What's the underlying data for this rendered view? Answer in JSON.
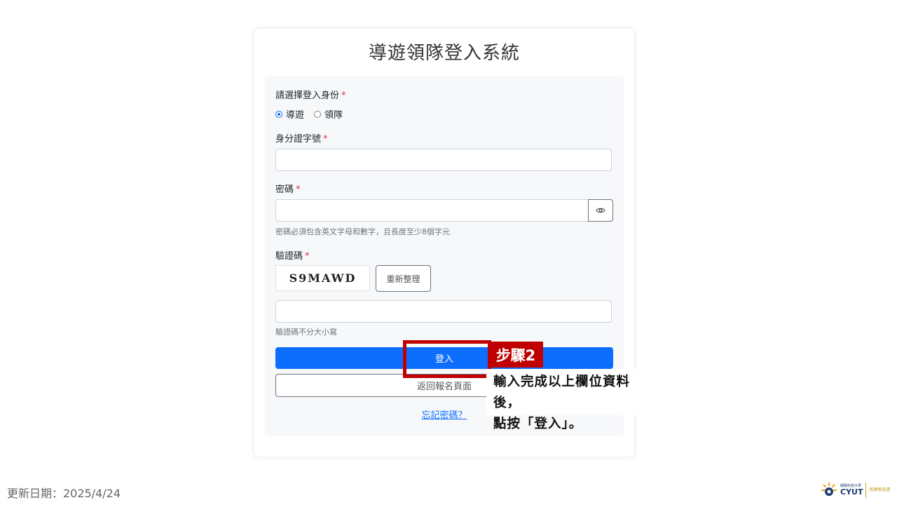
{
  "page": {
    "title": "導遊領隊登入系統"
  },
  "form": {
    "role_label": "請選擇登入身份",
    "required_mark": "*",
    "roles": [
      {
        "label": "導遊",
        "selected": true
      },
      {
        "label": "領隊",
        "selected": false
      }
    ],
    "id_label": "身分證字號",
    "id_value": "",
    "password_label": "密碼",
    "password_value": "",
    "password_hint": "密碼必須包含英文字母和數字，且長度至少8個字元",
    "captcha_label": "驗證碼",
    "captcha_code": "S9MAWD",
    "refresh_label": "重新整理",
    "captcha_value": "",
    "captcha_hint": "驗證碼不分大小寫",
    "login_label": "登入",
    "back_label": "返回報名頁面",
    "forgot_label": "忘記密碼？"
  },
  "annotation": {
    "step_label": "步驟2",
    "line1": "輸入完成以上欄位資料後，",
    "line2": "點按「登入」。"
  },
  "footer": {
    "update_text": "更新日期：2025/4/24",
    "logo_small": "朝陽科技大學",
    "logo_big": "CYUT",
    "logo_right": "推廣教育處"
  },
  "colors": {
    "primary": "#0d6efd",
    "required": "#dc3545",
    "annotation_red": "#c00000"
  },
  "icons": {
    "password_toggle": "eye-icon"
  }
}
